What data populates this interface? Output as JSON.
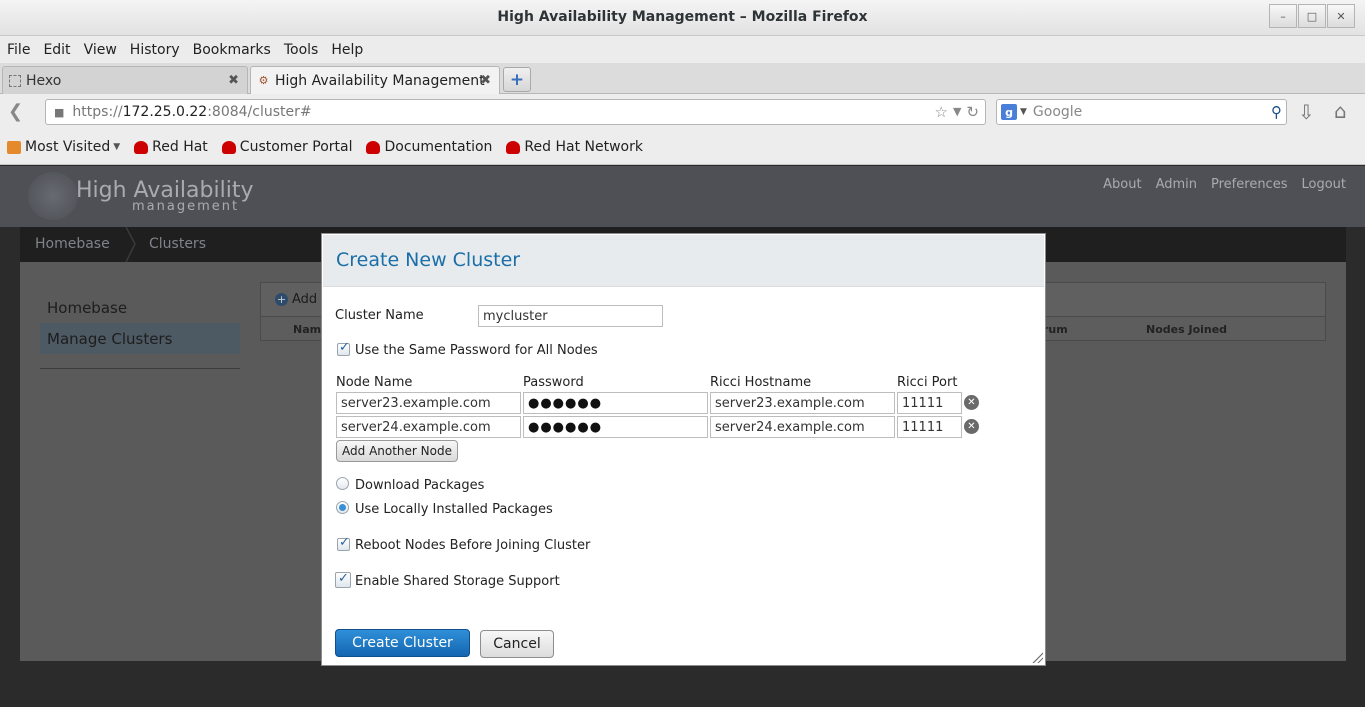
{
  "window": {
    "title": "High Availability Management – Mozilla Firefox",
    "controls": [
      "minimize-icon",
      "maximize-icon",
      "close-icon"
    ]
  },
  "menu": [
    "File",
    "Edit",
    "View",
    "History",
    "Bookmarks",
    "Tools",
    "Help"
  ],
  "tabs": [
    {
      "label": "Hexo",
      "active": false
    },
    {
      "label": "High Availability Management",
      "active": true
    }
  ],
  "nav": {
    "url_prefix": "https://",
    "url_host": "172.25.0.22",
    "url_rest": ":8084/cluster#",
    "search_placeholder": "Google"
  },
  "bookmarks": [
    {
      "label": "Most Visited",
      "icon": "folder-icon"
    },
    {
      "label": "Red Hat",
      "icon": "redhat-icon"
    },
    {
      "label": "Customer Portal",
      "icon": "redhat-icon"
    },
    {
      "label": "Documentation",
      "icon": "redhat-icon"
    },
    {
      "label": "Red Hat Network",
      "icon": "redhat-icon"
    }
  ],
  "app": {
    "brand_main": "High Availability",
    "brand_sub": "management",
    "top_links": [
      "About",
      "Admin",
      "Preferences",
      "Logout"
    ],
    "breadcrumb": [
      "Homebase",
      "Clusters"
    ],
    "sidebar": [
      {
        "label": "Homebase",
        "selected": false
      },
      {
        "label": "Manage Clusters",
        "selected": true
      }
    ],
    "add_label": "Add",
    "col_name": "Nam",
    "col_quorum": "rum",
    "col_nodes_joined": "Nodes Joined"
  },
  "dialog": {
    "title": "Create New Cluster",
    "cluster_name_label": "Cluster Name",
    "cluster_name_value": "mycluster",
    "same_password_label": "Use the Same Password for All Nodes",
    "same_password_checked": true,
    "columns": [
      "Node Name",
      "Password",
      "Ricci Hostname",
      "Ricci Port"
    ],
    "nodes": [
      {
        "name": "server23.example.com",
        "password": "●●●●●●",
        "hostname": "server23.example.com",
        "port": "11111"
      },
      {
        "name": "server24.example.com",
        "password": "●●●●●●",
        "hostname": "server24.example.com",
        "port": "11111"
      }
    ],
    "add_node_label": "Add Another Node",
    "download_packages_label": "Download Packages",
    "local_packages_label": "Use Locally Installed Packages",
    "package_option_selected": "Use Locally Installed Packages",
    "reboot_label": "Reboot Nodes Before Joining Cluster",
    "reboot_checked": true,
    "shared_storage_label": "Enable Shared Storage Support",
    "shared_storage_checked": true,
    "create_label": "Create Cluster",
    "cancel_label": "Cancel"
  },
  "colors": {
    "dialog_title": "#1a6fa8",
    "primary_button": "#1f7ac6",
    "overlay": "#2b2b2b"
  }
}
